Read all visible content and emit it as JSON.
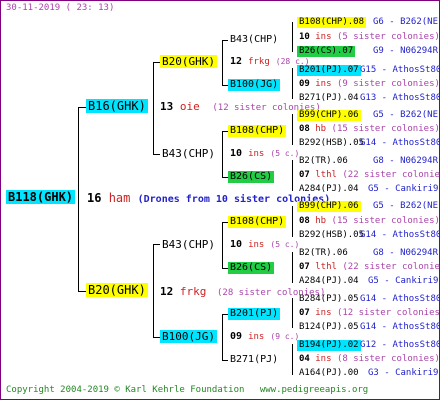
{
  "header": {
    "date": "30-11-2019 ( 23: 13)"
  },
  "footer": {
    "copyright": "Copyright 2004-2019 © Karl Kehrle Foundation",
    "url": "www.pedigreeapis.org"
  },
  "root": {
    "id": "B118(GHK)",
    "count": "16",
    "unit": "ham",
    "note": "(Drones from 10 sister colonies)"
  },
  "gen1": [
    {
      "id": "B16(GHK)",
      "count": "13",
      "unit": "oie",
      "note": "(12 sister colonies)"
    },
    {
      "id": "B20(GHK)",
      "count": "12",
      "unit": "frkg",
      "note": "(28 sister colonies)"
    }
  ],
  "gen2": [
    {
      "id": "B20(GHK)",
      "count": "12",
      "unit": "frkg",
      "note": "(28 sister colonies)"
    },
    {
      "id": "B43(CHP)",
      "count": "10",
      "unit": "ins",
      "note": "(5 c.)"
    },
    {
      "id": "B43(CHP)",
      "count": "10",
      "unit": "ins",
      "note": "(5 c.)"
    },
    {
      "id": "B100(JG)",
      "count": "09",
      "unit": "ins",
      "note": "(9 c.)"
    }
  ],
  "gen3": [
    {
      "id": "B43(CHP)"
    },
    {
      "id": "B100(JG)"
    },
    {
      "id": "B108(CHP)"
    },
    {
      "id": "B26(CS)"
    },
    {
      "id": "B108(CHP)"
    },
    {
      "id": "B26(CS)"
    },
    {
      "id": "B201(PJ)"
    },
    {
      "id": "B271(PJ)"
    }
  ],
  "gen3_counts": [
    {
      "count": "12",
      "unit": "frkg",
      "note": "(28 c.)"
    },
    {
      "count": "10",
      "unit": "ins",
      "note": "(5 c.)"
    },
    {
      "count": "09",
      "unit": "ins",
      "note": "(9 c.)"
    }
  ],
  "gen4": [
    {
      "id": "B108(CHP).08",
      "ref": "G6 - B262(NE)"
    },
    {
      "id": "10",
      "unit": "ins",
      "note": "(5 sister colonies)"
    },
    {
      "id": "B26(CS).07",
      "ref": "G9 - N06294R"
    },
    {
      "id": "B201(PJ).07",
      "ref": "G15 - AthosSt80R"
    },
    {
      "id": "09",
      "unit": "ins",
      "note": "(9 sister colonies)"
    },
    {
      "id": "B271(PJ).04",
      "ref": "G13 - AthosSt80R"
    },
    {
      "id": "B99(CHP).06",
      "ref": "G5 - B262(NE)"
    },
    {
      "id": "08",
      "unit": "hb",
      "note": "(15 sister colonies)"
    },
    {
      "id": "B292(HSB).05",
      "ref": "G14 - AthosSt80R"
    },
    {
      "id": "B2(TR).06",
      "ref": "G8 - N06294R"
    },
    {
      "id": "07",
      "unit": "lthl",
      "note": "(22 sister colonies)"
    },
    {
      "id": "A284(PJ).04",
      "ref": "G5 - Cankiri97Q"
    },
    {
      "id": "B99(CHP).06",
      "ref": "G5 - B262(NE)"
    },
    {
      "id": "08",
      "unit": "hb",
      "note": "(15 sister colonies)"
    },
    {
      "id": "B292(HSB).05",
      "ref": "G14 - AthosSt80R"
    },
    {
      "id": "B2(TR).06",
      "ref": "G8 - N06294R"
    },
    {
      "id": "07",
      "unit": "lthl",
      "note": "(22 sister colonies)"
    },
    {
      "id": "A284(PJ).04",
      "ref": "G5 - Cankiri97Q"
    },
    {
      "id": "B284(PJ).05",
      "ref": "G14 - AthosSt80R"
    },
    {
      "id": "07",
      "unit": "ins",
      "note": "(12 sister colonies)"
    },
    {
      "id": "B124(PJ).05",
      "ref": "G14 - AthosSt80R"
    },
    {
      "id": "B194(PJ).02",
      "ref": "G12 - AthosSt80R"
    },
    {
      "id": "04",
      "unit": "ins",
      "note": "(8 sister colonies)"
    },
    {
      "id": "A164(PJ).00",
      "ref": "G3 - Cankiri97Q"
    }
  ],
  "colors": {
    "cyan": "#00e5ff",
    "yellow": "#ffff00",
    "green": "#22cc44",
    "frame": "#800080"
  }
}
